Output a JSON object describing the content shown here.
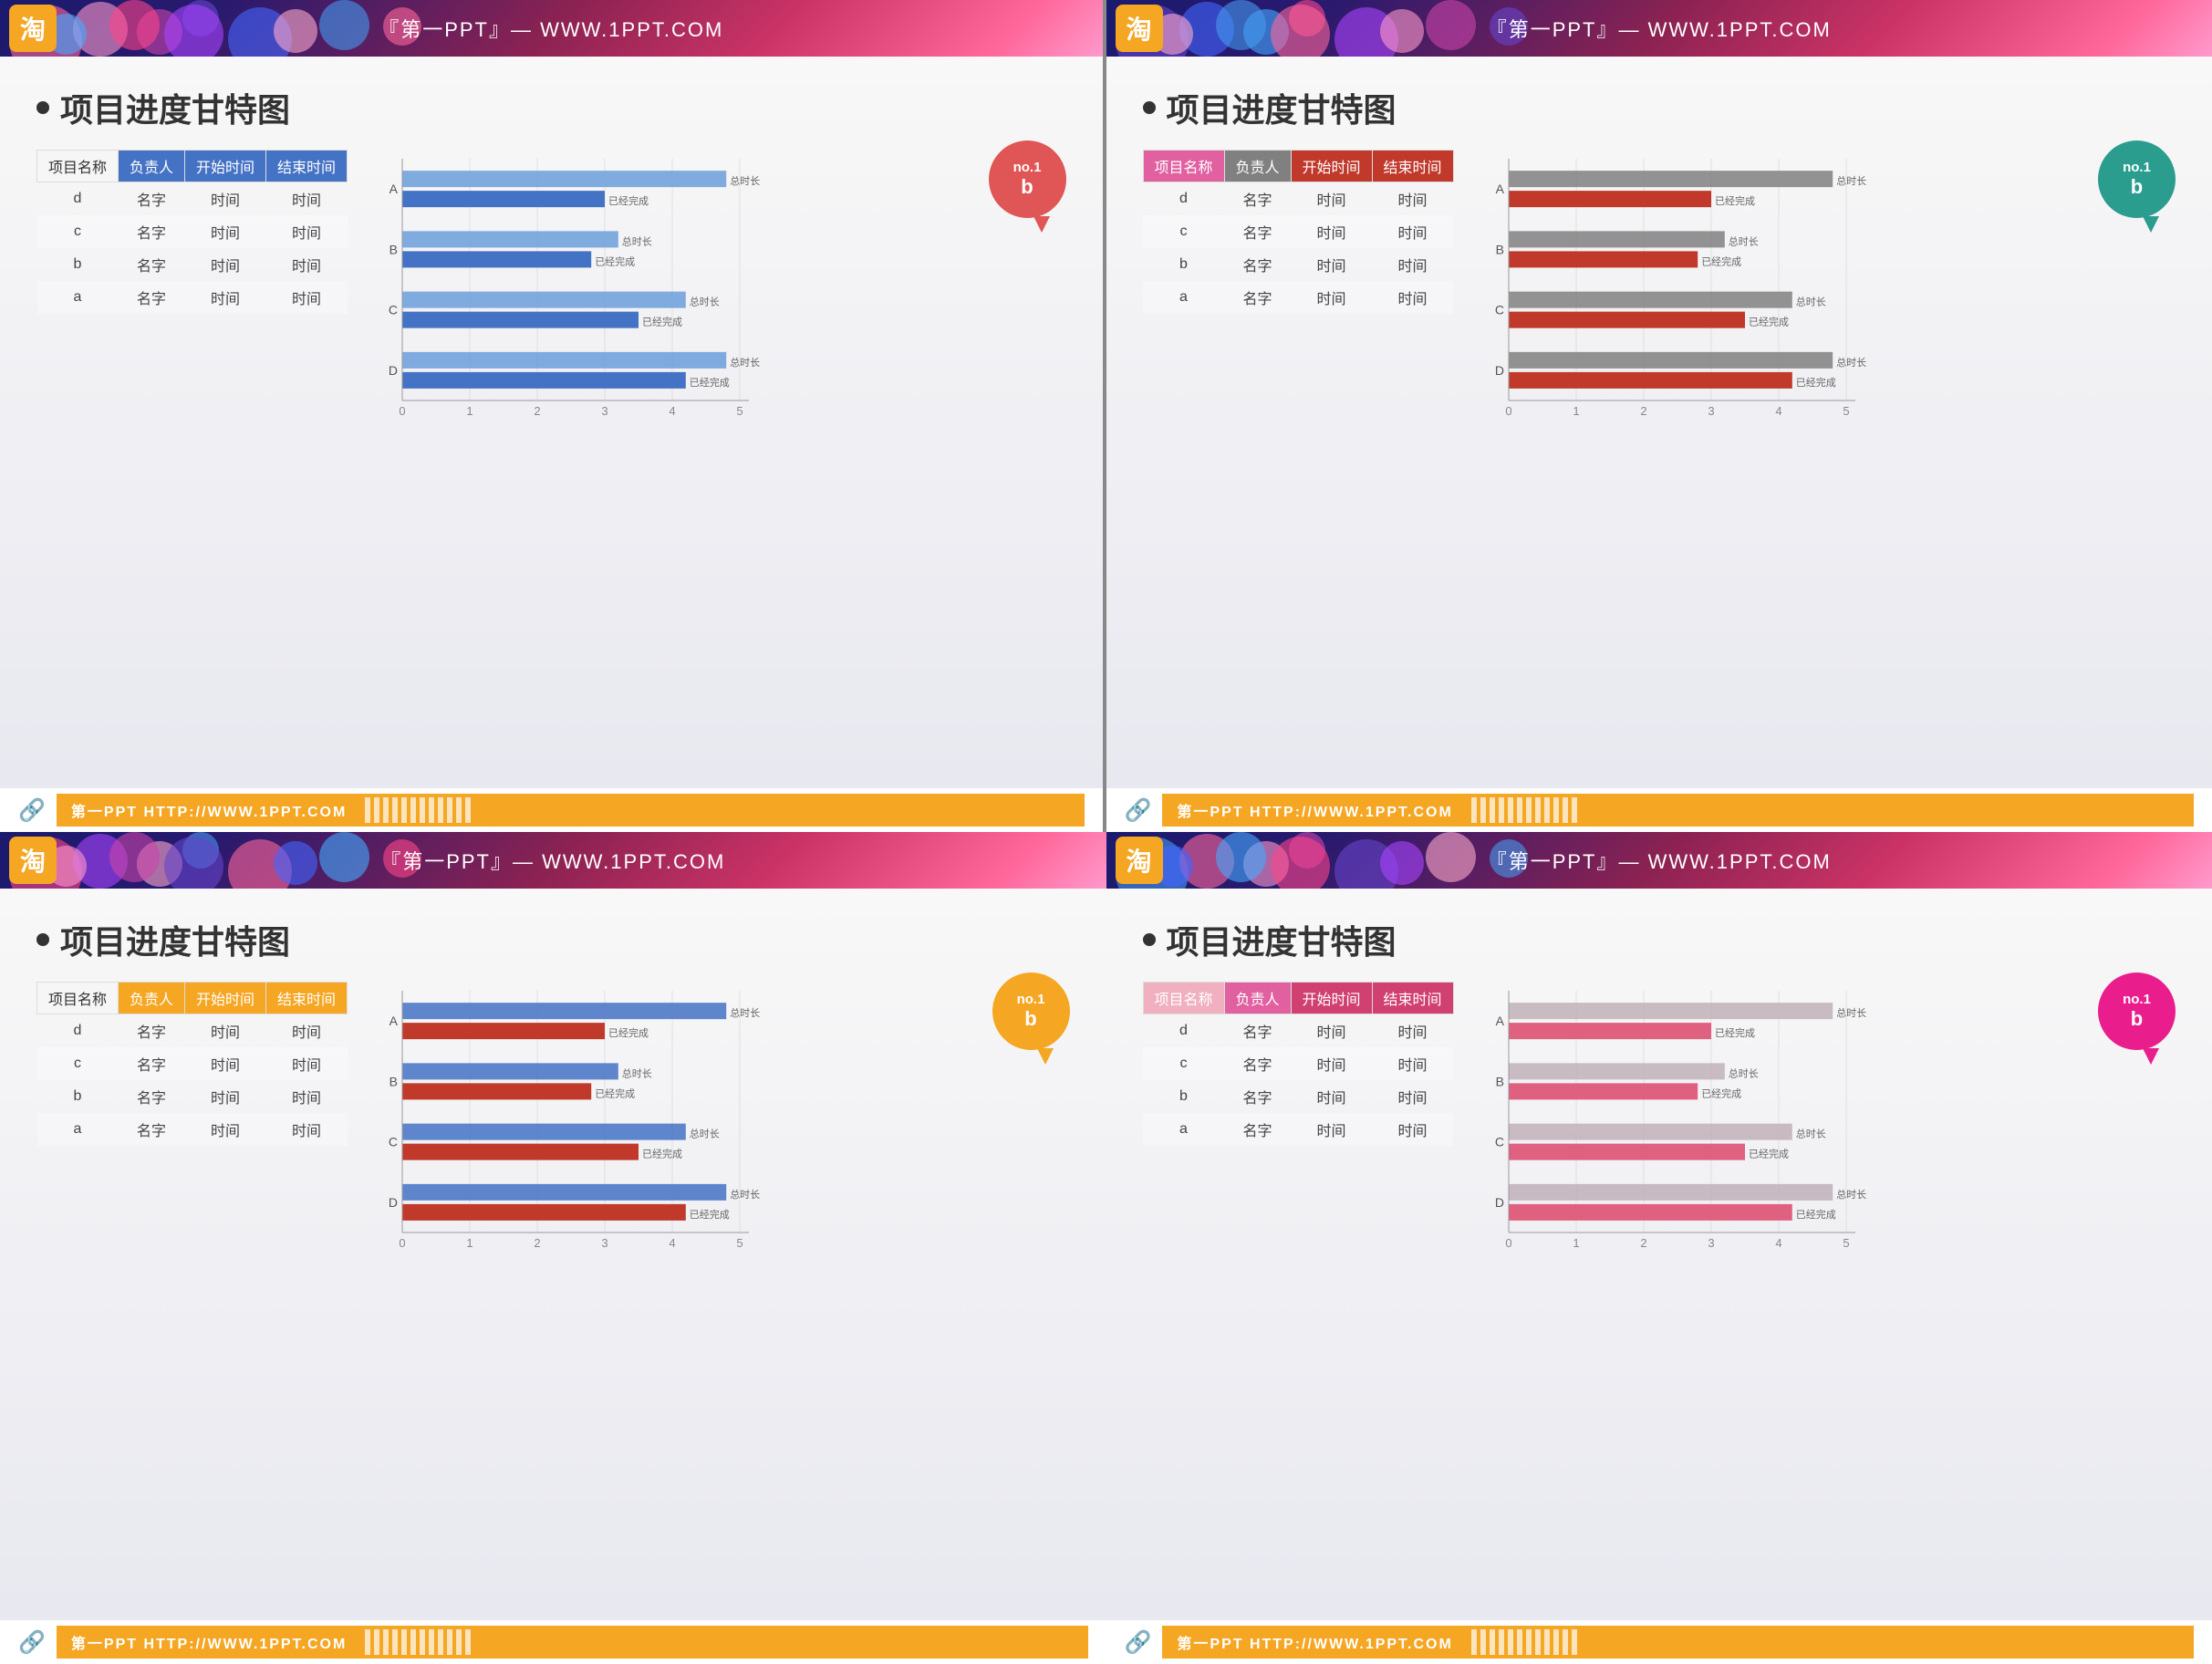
{
  "slides": [
    {
      "id": "slide1",
      "header": {
        "logo": "淘",
        "title": "『第一PPT』— WWW.1PPT.COM"
      },
      "title": "项目进度甘特图",
      "bubble": {
        "text_top": "no.1",
        "text_bottom": "b",
        "color": "#e05555"
      },
      "table": {
        "headers": [
          "项目名称",
          "负责人",
          "开始时间",
          "结束时间"
        ],
        "header_colors": [
          "none",
          "blue",
          "blue",
          "blue"
        ],
        "rows": [
          [
            "d",
            "名字",
            "时间",
            "时间"
          ],
          [
            "c",
            "名字",
            "时间",
            "时间"
          ],
          [
            "b",
            "名字",
            "时间",
            "时间"
          ],
          [
            "a",
            "名字",
            "时间",
            "时间"
          ]
        ]
      },
      "chart": {
        "theme": "blue",
        "bars": [
          {
            "label": "D",
            "completed": 4.2,
            "total": 4.8,
            "completed_label": "已经完成",
            "total_label": "总时长"
          },
          {
            "label": "C",
            "completed": 3.5,
            "total": 4.2,
            "completed_label": "已经完成",
            "total_label": "总时长"
          },
          {
            "label": "B",
            "completed": 2.8,
            "total": 3.2,
            "completed_label": "已经完成",
            "total_label": "总时长"
          },
          {
            "label": "A",
            "completed": 3.0,
            "total": 4.8,
            "completed_label": "已经完成",
            "total_label": "总时长"
          }
        ],
        "axis_max": 5,
        "axis_ticks": [
          0,
          1,
          2,
          3,
          4,
          5
        ]
      },
      "footer": {
        "text": "第一PPT HTTP://WWW.1PPT.COM",
        "icon": "🔗",
        "stripe_color": "#f5a623"
      }
    },
    {
      "id": "slide2",
      "header": {
        "logo": "淘",
        "title": "『第一PPT』— WWW.1PPT.COM"
      },
      "title": "项目进度甘特图",
      "bubble": {
        "text_top": "no.1",
        "text_bottom": "b",
        "color": "#2a9d8f"
      },
      "table": {
        "headers": [
          "项目名称",
          "负责人",
          "开始时间",
          "结束时间"
        ],
        "header_colors": [
          "pink",
          "gray",
          "red",
          "red"
        ],
        "rows": [
          [
            "d",
            "名字",
            "时间",
            "时间"
          ],
          [
            "c",
            "名字",
            "时间",
            "时间"
          ],
          [
            "b",
            "名字",
            "时间",
            "时间"
          ],
          [
            "a",
            "名字",
            "时间",
            "时间"
          ]
        ]
      },
      "chart": {
        "theme": "redgray",
        "bars": [
          {
            "label": "D",
            "completed": 4.2,
            "total": 4.8,
            "completed_label": "已经完成",
            "total_label": "总时长"
          },
          {
            "label": "C",
            "completed": 3.5,
            "total": 4.2,
            "completed_label": "已经完成",
            "total_label": "总时长"
          },
          {
            "label": "B",
            "completed": 2.8,
            "total": 3.2,
            "completed_label": "已经完成",
            "total_label": "总时长"
          },
          {
            "label": "A",
            "completed": 3.0,
            "total": 4.8,
            "completed_label": "已经完成",
            "total_label": "总时长"
          }
        ],
        "axis_max": 5,
        "axis_ticks": [
          0,
          1,
          2,
          3,
          4,
          5
        ]
      },
      "footer": {
        "text": "第一PPT HTTP://WWW.1PPT.COM",
        "icon": "🔗",
        "stripe_color": "#f5a623"
      }
    },
    {
      "id": "slide3",
      "header": {
        "logo": "淘",
        "title": "『第一PPT』— WWW.1PPT.COM"
      },
      "title": "项目进度甘特图",
      "bubble": {
        "text_top": "no.1",
        "text_bottom": "b",
        "color": "#f5a623"
      },
      "table": {
        "headers": [
          "项目名称",
          "负责人",
          "开始时间",
          "结束时间"
        ],
        "header_colors": [
          "none",
          "orange",
          "orange",
          "orange"
        ],
        "rows": [
          [
            "d",
            "名字",
            "时间",
            "时间"
          ],
          [
            "c",
            "名字",
            "时间",
            "时间"
          ],
          [
            "b",
            "名字",
            "时间",
            "时间"
          ],
          [
            "a",
            "名字",
            "时间",
            "时间"
          ]
        ]
      },
      "chart": {
        "theme": "redblue",
        "bars": [
          {
            "label": "D",
            "completed": 4.2,
            "total": 4.8,
            "completed_label": "已经完成",
            "total_label": "总时长"
          },
          {
            "label": "C",
            "completed": 3.5,
            "total": 4.2,
            "completed_label": "已经完成",
            "total_label": "总时长"
          },
          {
            "label": "B",
            "completed": 2.8,
            "total": 3.2,
            "completed_label": "已经完成",
            "total_label": "总时长"
          },
          {
            "label": "A",
            "completed": 3.0,
            "total": 4.8,
            "completed_label": "已经完成",
            "total_label": "总时长"
          }
        ],
        "axis_max": 5,
        "axis_ticks": [
          0,
          1,
          2,
          3,
          4,
          5
        ]
      },
      "footer": {
        "text": "第一PPT HTTP://WWW.1PPT.COM",
        "icon": "🔗",
        "stripe_color": "#f5a623"
      }
    },
    {
      "id": "slide4",
      "header": {
        "logo": "淘",
        "title": "『第一PPT』— WWW.1PPT.COM"
      },
      "title": "项目进度甘特图",
      "bubble": {
        "text_top": "no.1",
        "text_bottom": "b",
        "color": "#e91e8c"
      },
      "table": {
        "headers": [
          "项目名称",
          "负责人",
          "开始时间",
          "结束时间"
        ],
        "header_colors": [
          "lpink",
          "pink",
          "pink2",
          "pink2"
        ],
        "rows": [
          [
            "d",
            "名字",
            "时间",
            "时间"
          ],
          [
            "c",
            "名字",
            "时间",
            "时间"
          ],
          [
            "b",
            "名字",
            "时间",
            "时间"
          ],
          [
            "a",
            "名字",
            "时间",
            "时间"
          ]
        ]
      },
      "chart": {
        "theme": "pinkgray",
        "bars": [
          {
            "label": "D",
            "completed": 4.2,
            "total": 4.8,
            "completed_label": "已经完成",
            "total_label": "总时长"
          },
          {
            "label": "C",
            "completed": 3.5,
            "total": 4.2,
            "completed_label": "已经完成",
            "total_label": "总时长"
          },
          {
            "label": "B",
            "completed": 2.8,
            "total": 3.2,
            "completed_label": "已经完成",
            "total_label": "总时长"
          },
          {
            "label": "A",
            "completed": 3.0,
            "total": 4.8,
            "completed_label": "已经完成",
            "total_label": "总时长"
          }
        ],
        "axis_max": 5,
        "axis_ticks": [
          0,
          1,
          2,
          3,
          4,
          5
        ]
      },
      "footer": {
        "text": "第一PPT HTTP://WWW.1PPT.COM",
        "icon": "🔗",
        "stripe_color": "#f5a623"
      }
    }
  ]
}
